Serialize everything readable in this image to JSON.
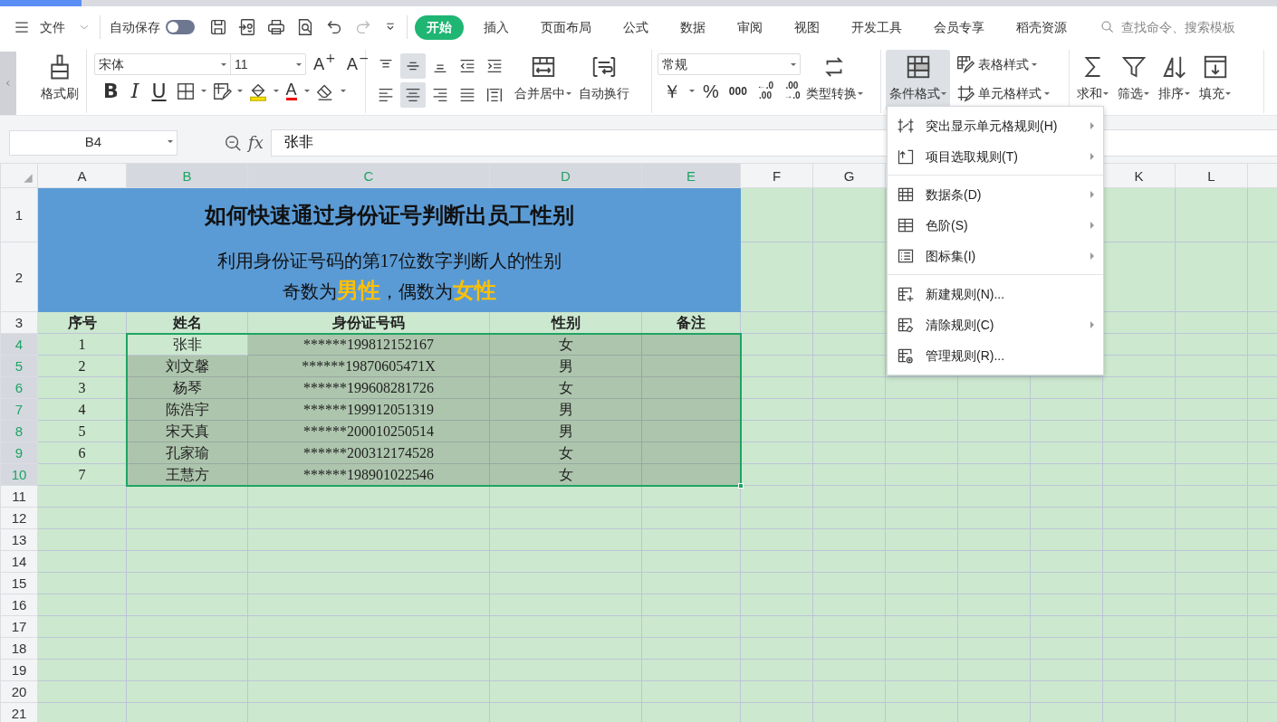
{
  "quick_bar": {
    "file_label": "文件",
    "autosave_label": "自动保存",
    "autosave_on": false
  },
  "tabs": [
    {
      "label": "开始",
      "selected": true
    },
    {
      "label": "插入",
      "selected": false
    },
    {
      "label": "页面布局",
      "selected": false
    },
    {
      "label": "公式",
      "selected": false
    },
    {
      "label": "数据",
      "selected": false
    },
    {
      "label": "审阅",
      "selected": false
    },
    {
      "label": "视图",
      "selected": false
    },
    {
      "label": "开发工具",
      "selected": false
    },
    {
      "label": "会员专享",
      "selected": false
    },
    {
      "label": "稻壳资源",
      "selected": false
    }
  ],
  "search": {
    "placeholder": "查找命令、搜索模板"
  },
  "ribbon": {
    "format_painter": "格式刷",
    "font": {
      "name": "宋体",
      "size": "11",
      "grow": "A$^{+}$",
      "shrink": "A$^{−}$",
      "bold": "B",
      "italic": "I",
      "underline": "U",
      "font_color": "A"
    },
    "alignment": {
      "buttons": [
        {
          "kind": "top",
          "selected": false
        },
        {
          "kind": "middle",
          "selected": true
        },
        {
          "kind": "bottom",
          "selected": false
        },
        {
          "kind": "outdent",
          "selected": false
        },
        {
          "kind": "indent",
          "selected": false
        },
        {
          "kind": "left",
          "selected": false
        },
        {
          "kind": "center",
          "selected": true
        },
        {
          "kind": "right",
          "selected": false
        },
        {
          "kind": "justify",
          "selected": false
        },
        {
          "kind": "distribute",
          "selected": false
        }
      ],
      "merge": "合并居中",
      "wrap": "自动换行"
    },
    "number": {
      "format": "常规",
      "currency": "￥",
      "percent": "%",
      "thousands": "000",
      "decimals": [
        {
          "top": "←.0",
          "bottom": ".00"
        },
        {
          "top": ".00",
          "bottom": "→.0"
        }
      ],
      "convert": "类型转换"
    },
    "styles": {
      "conditional": {
        "label": "条件格式",
        "expanded": true
      },
      "table_style": "表格样式",
      "cell_style": "单元格样式"
    },
    "editing": [
      {
        "kind": "sum",
        "label": "求和"
      },
      {
        "kind": "filter",
        "label": "筛选"
      },
      {
        "kind": "sort",
        "label": "排序"
      },
      {
        "kind": "fill",
        "label": "填充"
      }
    ]
  },
  "formula_bar": {
    "cell_ref": "B4",
    "function_label": "fx",
    "value": "张非"
  },
  "sheet": {
    "columns": [
      {
        "letter": "A",
        "selected": false
      },
      {
        "letter": "B",
        "selected": true
      },
      {
        "letter": "C",
        "selected": true
      },
      {
        "letter": "D",
        "selected": true
      },
      {
        "letter": "E",
        "selected": true
      },
      {
        "letter": "F",
        "selected": false
      },
      {
        "letter": "G",
        "selected": false
      },
      {},
      {},
      {},
      {
        "letter": "K",
        "selected": false
      },
      {
        "letter": "L",
        "selected": false
      },
      {
        "selected": false
      }
    ],
    "rows": [
      {
        "header": "1",
        "kind": "title",
        "selected": false,
        "text": "如何快速通过身份证号判断出员工性别"
      },
      {
        "header": "2",
        "kind": "subtitle",
        "selected": false,
        "lines": [
          "利用身份证号码的第17位数字判断人的性别",
          "奇数为**男性**，偶数为**女性**"
        ]
      },
      {
        "header": "3",
        "kind": "heading",
        "selected": false,
        "cells": [
          "序号",
          "姓名",
          "身份证号码",
          "性别",
          "备注"
        ]
      },
      {
        "header": "4",
        "kind": "data",
        "selected": true,
        "cells": [
          "1",
          "张非",
          "******199812152167",
          "女"
        ]
      },
      {
        "header": "5",
        "kind": "data",
        "selected": true,
        "cells": [
          "2",
          "刘文馨",
          "******19870605471X",
          "男"
        ]
      },
      {
        "header": "6",
        "kind": "data",
        "selected": true,
        "cells": [
          "3",
          "杨琴",
          "******199608281726",
          "女"
        ]
      },
      {
        "header": "7",
        "kind": "data",
        "selected": true,
        "cells": [
          "4",
          "陈浩宇",
          "******199912051319",
          "男"
        ]
      },
      {
        "header": "8",
        "kind": "data",
        "selected": true,
        "cells": [
          "5",
          "宋天真",
          "******200010250514",
          "男"
        ]
      },
      {
        "header": "9",
        "kind": "data",
        "selected": true,
        "cells": [
          "6",
          "孔家瑜",
          "******200312174528",
          "女"
        ]
      },
      {
        "header": "10",
        "kind": "data",
        "selected": true,
        "cells": [
          "7",
          "王慧方",
          "******198901022546",
          "女"
        ]
      },
      {
        "header": "11",
        "kind": "blank",
        "selected": false
      },
      {
        "header": "12",
        "kind": "blank",
        "selected": false
      },
      {
        "header": "13",
        "kind": "blank",
        "selected": false
      },
      {
        "header": "14",
        "kind": "blank",
        "selected": false
      },
      {
        "header": "15",
        "kind": "blank",
        "selected": false
      },
      {
        "header": "16",
        "kind": "blank",
        "selected": false
      },
      {
        "header": "17",
        "kind": "blank",
        "selected": false
      },
      {
        "header": "18",
        "kind": "blank",
        "selected": false
      },
      {
        "header": "19",
        "kind": "blank",
        "selected": false
      },
      {
        "header": "20",
        "kind": "blank",
        "selected": false
      },
      {
        "header": "21",
        "kind": "blank",
        "selected": false
      }
    ]
  },
  "conditional_format_menu": {
    "sections": [
      {
        "items": [
          {
            "kind": "highlight",
            "label": "突出显示单元格规则(H)",
            "submenu": true
          },
          {
            "kind": "top",
            "label": "项目选取规则(T)",
            "submenu": true
          }
        ]
      },
      {
        "items": [
          {
            "kind": "databar",
            "label": "数据条(D)",
            "submenu": true
          },
          {
            "kind": "colorscale",
            "label": "色阶(S)",
            "submenu": true
          },
          {
            "kind": "iconset",
            "label": "图标集(I)",
            "submenu": true
          }
        ]
      },
      {
        "items": [
          {
            "kind": "new",
            "label": "新建规则(N)...",
            "submenu": false
          },
          {
            "kind": "clear",
            "label": "清除规则(C)",
            "submenu": true
          },
          {
            "kind": "manage",
            "label": "管理规则(R)...",
            "submenu": false
          }
        ]
      }
    ]
  }
}
